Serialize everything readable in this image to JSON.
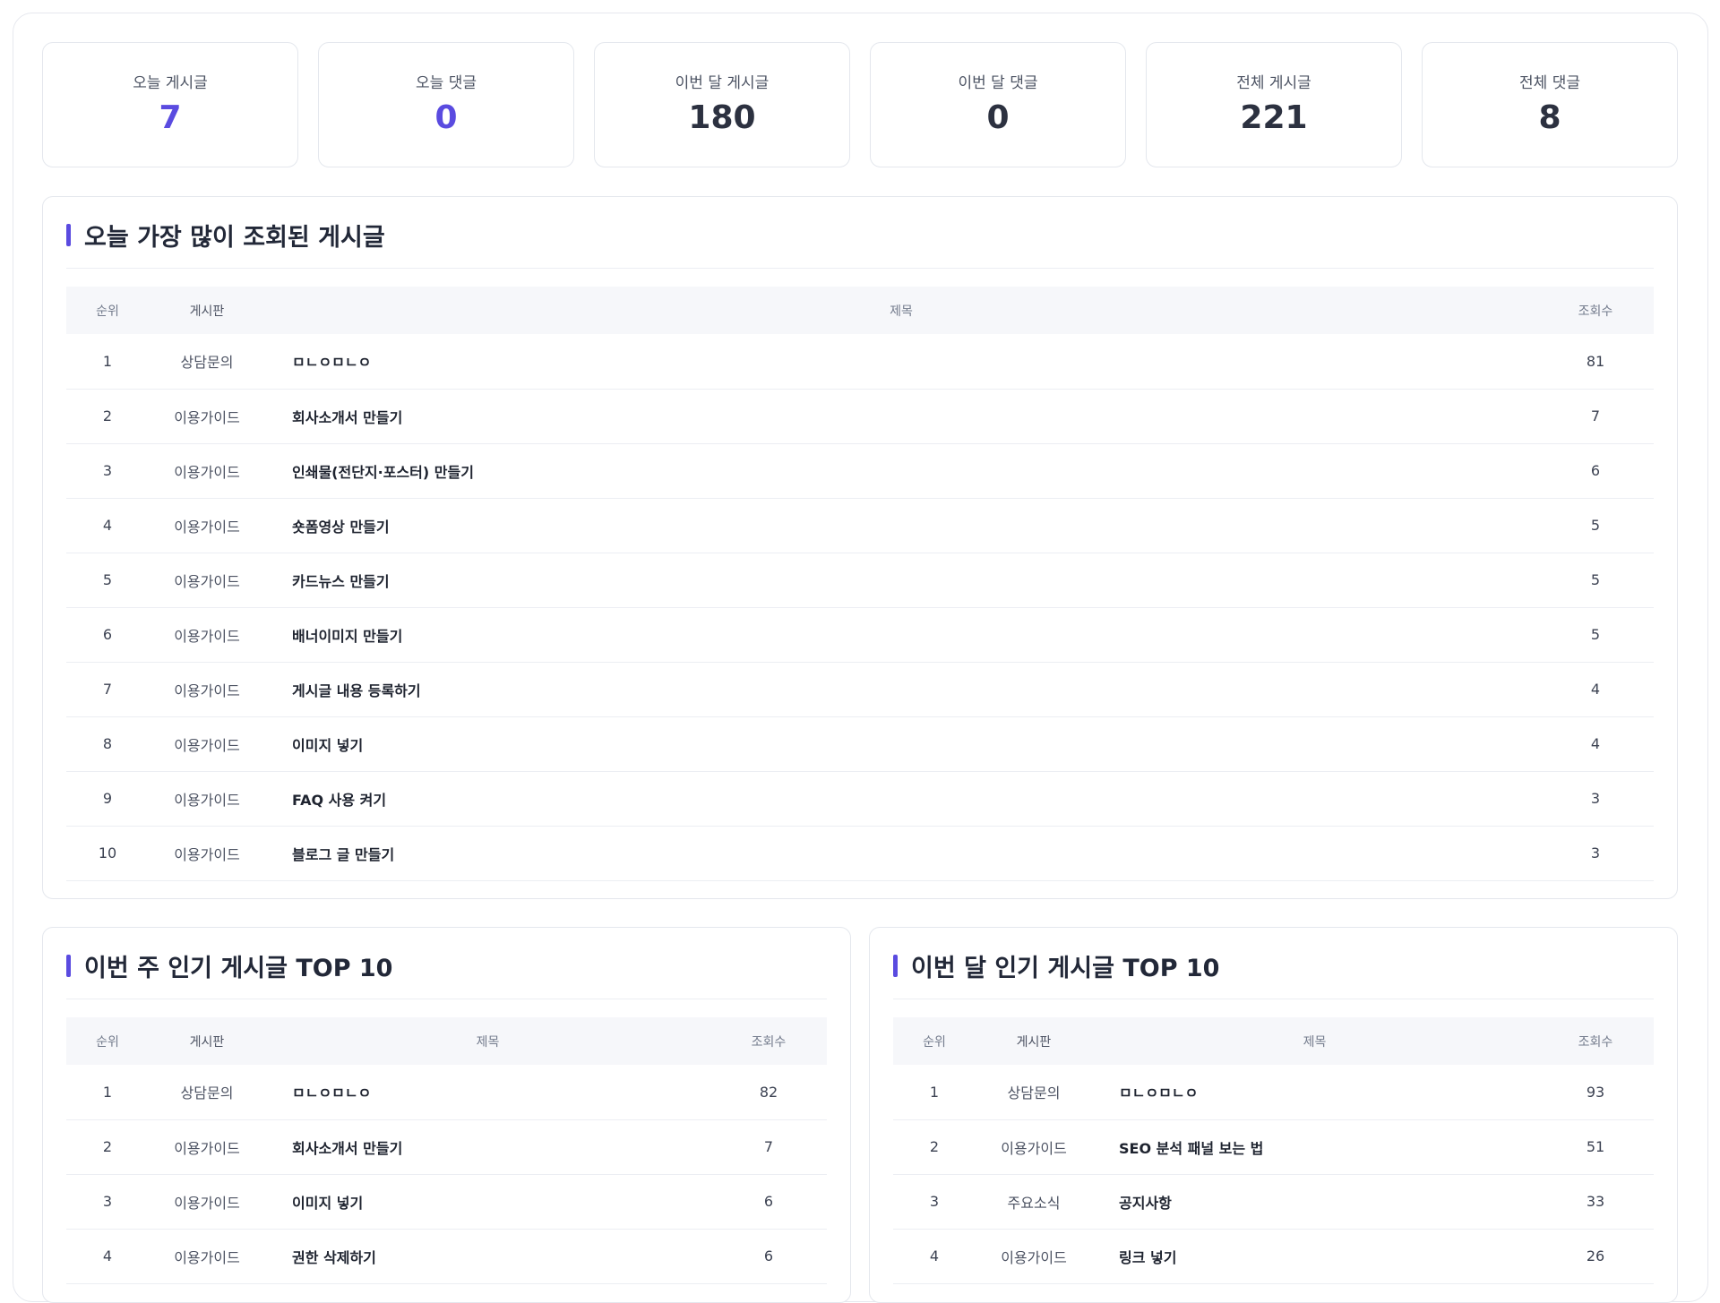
{
  "stats": [
    {
      "label": "오늘 게시글",
      "value": "7",
      "accent": true
    },
    {
      "label": "오늘 댓글",
      "value": "0",
      "accent": true
    },
    {
      "label": "이번 달 게시글",
      "value": "180",
      "accent": false
    },
    {
      "label": "이번 달 댓글",
      "value": "0",
      "accent": false
    },
    {
      "label": "전체 게시글",
      "value": "221",
      "accent": false
    },
    {
      "label": "전체 댓글",
      "value": "8",
      "accent": false
    }
  ],
  "colors": {
    "accent": "#5a4be0",
    "value_dark": "#2c3140"
  },
  "columns": {
    "rank": "순위",
    "board": "게시판",
    "title": "제목",
    "views": "조회수"
  },
  "today": {
    "title": "오늘 가장 많이 조회된 게시글",
    "rows": [
      {
        "rank": "1",
        "board": "상담문의",
        "title": "ㅁㄴㅇㅁㄴㅇ",
        "views": "81"
      },
      {
        "rank": "2",
        "board": "이용가이드",
        "title": "회사소개서 만들기",
        "views": "7"
      },
      {
        "rank": "3",
        "board": "이용가이드",
        "title": "인쇄물(전단지·포스터) 만들기",
        "views": "6"
      },
      {
        "rank": "4",
        "board": "이용가이드",
        "title": "숏폼영상 만들기",
        "views": "5"
      },
      {
        "rank": "5",
        "board": "이용가이드",
        "title": "카드뉴스 만들기",
        "views": "5"
      },
      {
        "rank": "6",
        "board": "이용가이드",
        "title": "배너이미지 만들기",
        "views": "5"
      },
      {
        "rank": "7",
        "board": "이용가이드",
        "title": "게시글 내용 등록하기",
        "views": "4"
      },
      {
        "rank": "8",
        "board": "이용가이드",
        "title": "이미지 넣기",
        "views": "4"
      },
      {
        "rank": "9",
        "board": "이용가이드",
        "title": "FAQ 사용 켜기",
        "views": "3"
      },
      {
        "rank": "10",
        "board": "이용가이드",
        "title": "블로그 글 만들기",
        "views": "3"
      }
    ]
  },
  "week": {
    "title": "이번 주 인기 게시글 TOP 10",
    "rows": [
      {
        "rank": "1",
        "board": "상담문의",
        "title": "ㅁㄴㅇㅁㄴㅇ",
        "views": "82"
      },
      {
        "rank": "2",
        "board": "이용가이드",
        "title": "회사소개서 만들기",
        "views": "7"
      },
      {
        "rank": "3",
        "board": "이용가이드",
        "title": "이미지 넣기",
        "views": "6"
      },
      {
        "rank": "4",
        "board": "이용가이드",
        "title": "권한 삭제하기",
        "views": "6"
      }
    ]
  },
  "month": {
    "title": "이번 달 인기 게시글 TOP 10",
    "rows": [
      {
        "rank": "1",
        "board": "상담문의",
        "title": "ㅁㄴㅇㅁㄴㅇ",
        "views": "93"
      },
      {
        "rank": "2",
        "board": "이용가이드",
        "title": "SEO 분석 패널 보는 법",
        "views": "51"
      },
      {
        "rank": "3",
        "board": "주요소식",
        "title": "공지사항",
        "views": "33"
      },
      {
        "rank": "4",
        "board": "이용가이드",
        "title": "링크 넣기",
        "views": "26"
      }
    ]
  }
}
